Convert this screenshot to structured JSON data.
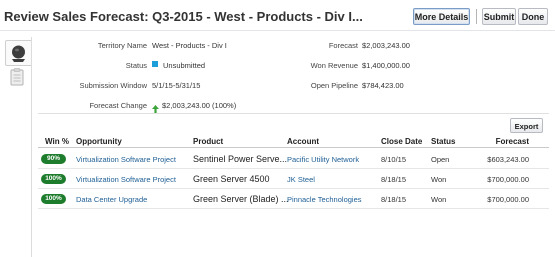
{
  "header": {
    "title": "Review Sales Forecast: Q3-2015 - West - Products - Div I...",
    "more_details": "More Details",
    "submit": "Submit",
    "done": "Done"
  },
  "summary": {
    "territory_name_label": "Territory Name",
    "territory_name_value": "West - Products - Div I",
    "status_label": "Status",
    "status_value": "Unsubmitted",
    "status_color": "#1c9ed8",
    "submission_window_label": "Submission Window",
    "submission_window_value": "5/1/15-5/31/15",
    "forecast_change_label": "Forecast Change",
    "forecast_change_value": "$2,003,243.00 (100%)",
    "forecast_label": "Forecast",
    "forecast_value": "$2,003,243.00",
    "won_revenue_label": "Won Revenue",
    "won_revenue_value": "$1,400,000.00",
    "open_pipeline_label": "Open Pipeline",
    "open_pipeline_value": "$784,423.00"
  },
  "table": {
    "export_label": "Export",
    "columns": {
      "win": "Win %",
      "opportunity": "Opportunity",
      "product": "Product",
      "account": "Account",
      "close_date": "Close Date",
      "status": "Status",
      "forecast": "Forecast"
    },
    "rows": [
      {
        "win": "90%",
        "opportunity": "Virtualization Software Project",
        "product": "Sentinel Power Serve...",
        "account": "Pacific Utility Network",
        "close_date": "8/10/15",
        "status": "Open",
        "forecast": "$603,243.00"
      },
      {
        "win": "100%",
        "opportunity": "Virtualization Software Project",
        "product": "Green Server 4500",
        "account": "JK Steel",
        "close_date": "8/18/15",
        "status": "Won",
        "forecast": "$700,000.00"
      },
      {
        "win": "100%",
        "opportunity": "Data Center Upgrade",
        "product": "Green Server (Blade) ...",
        "account": "Pinnacle Technologies",
        "close_date": "8/18/15",
        "status": "Won",
        "forecast": "$700,000.00"
      }
    ]
  },
  "colors": {
    "badge_green": "#1e7d2c",
    "link_blue": "#1f5f95",
    "arrow_green": "#3ca43a"
  },
  "icons": [
    "globe-icon",
    "clipboard-icon",
    "arrow-up-icon"
  ]
}
